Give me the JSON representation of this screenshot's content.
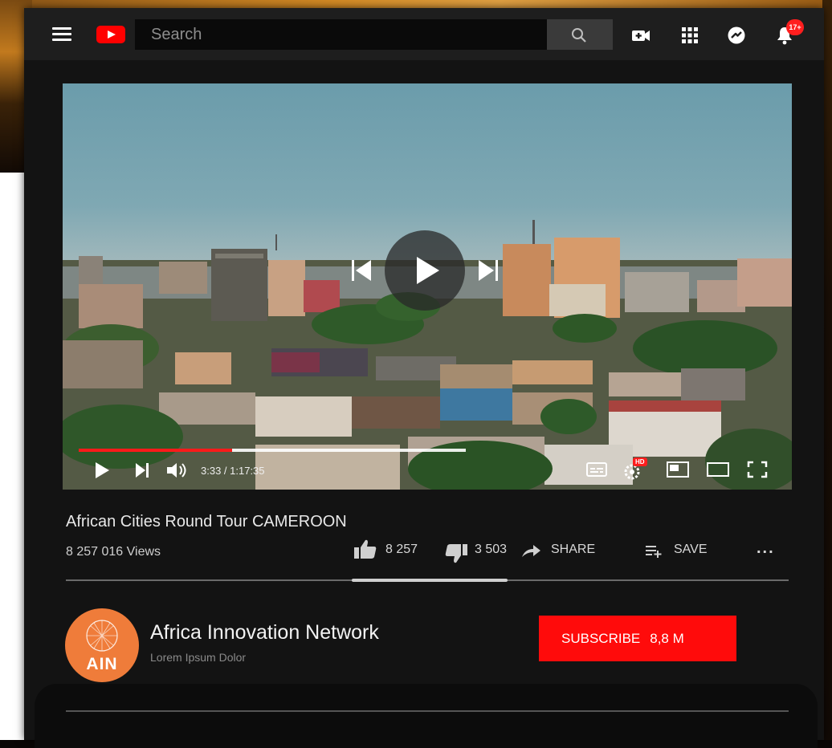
{
  "topbar": {
    "search_placeholder": "Search",
    "notification_badge": "17+"
  },
  "player": {
    "time": "3:33 / 1:17:35",
    "progress": 0.396,
    "hd_badge": "HD"
  },
  "video": {
    "title": "African Cities Round Tour CAMEROON",
    "views": "8 257 016 Views",
    "likes": "8 257",
    "dislikes": "3 503",
    "share_label": "SHARE",
    "save_label": "SAVE",
    "more_label": "..."
  },
  "channel": {
    "name": "Africa Innovation Network",
    "subtitle": "Lorem Ipsum Dolor",
    "avatar_text": "AIN",
    "subscribe_label": "SUBSCRIBE",
    "subscriber_count": "8,8 M"
  },
  "colors": {
    "accent": "#ff0000",
    "avatar": "#ef7c3a",
    "background": "#131313",
    "topbar": "#1e1e1e"
  }
}
